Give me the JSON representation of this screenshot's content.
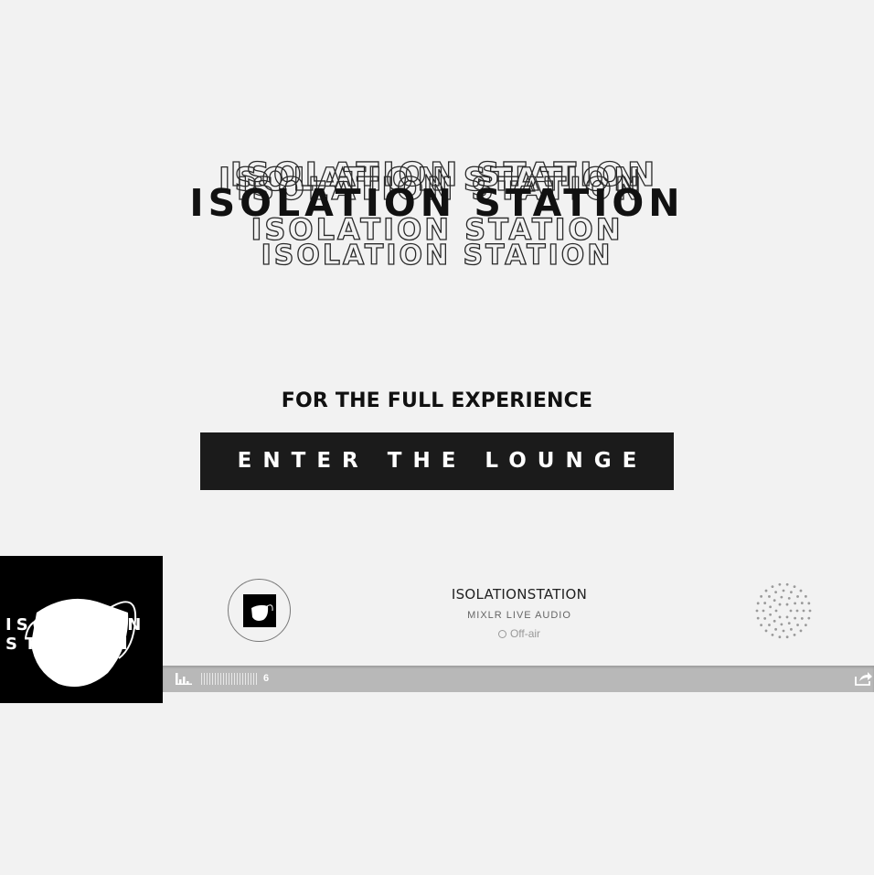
{
  "hero": {
    "title": "ISOLATION STATION"
  },
  "subtitle": "FOR THE FULL EXPERIENCE",
  "enter_button": "ENTER THE LOUNGE",
  "player": {
    "artwork_line1": "ISOLATION",
    "artwork_line2": "STATION",
    "station_name": "ISOLATIONSTATION",
    "station_sub": "MIXLR LIVE AUDIO",
    "status": "Off-air",
    "listeners": "6"
  },
  "icons": {
    "volume": "volume-bars-icon",
    "share": "share-icon",
    "spinner": "dotted-spinner-icon"
  },
  "colors": {
    "background": "#f2f2f2",
    "button": "#1b1b1b",
    "toolbar": "#b8b8b8"
  }
}
